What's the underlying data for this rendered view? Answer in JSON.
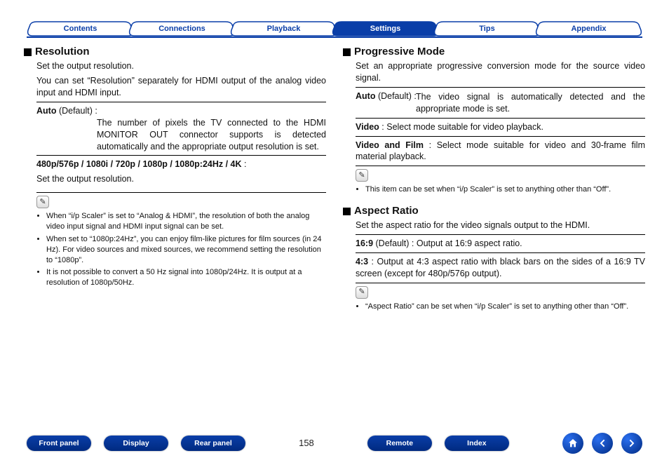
{
  "topnav": {
    "tabs": [
      {
        "label": "Contents",
        "active": false
      },
      {
        "label": "Connections",
        "active": false
      },
      {
        "label": "Playback",
        "active": false
      },
      {
        "label": "Settings",
        "active": true
      },
      {
        "label": "Tips",
        "active": false
      },
      {
        "label": "Appendix",
        "active": false
      }
    ]
  },
  "left": {
    "resolution": {
      "title": "Resolution",
      "intro1": "Set the output resolution.",
      "intro2": "You can set “Resolution” separately for HDMI output of the analog video input and HDMI input.",
      "auto_term": "Auto",
      "auto_default": " (Default) : ",
      "auto_desc": "The number of pixels the TV connected to the HDMI MONITOR OUT connector supports is detected automatically and the appropriate output resolution is set.",
      "modes_term": "480p/576p / 1080i / 720p / 1080p / 1080p:24Hz / 4K",
      "modes_colon": " :",
      "modes_desc": "Set the output resolution.",
      "notes": [
        "When “i/p Scaler” is set to “Analog & HDMI”, the resolution of both the analog video input signal and HDMI input signal can be set.",
        "When set to “1080p:24Hz”, you can enjoy film-like pictures for film sources (in 24 Hz). For video sources and mixed sources, we recommend setting the resolution to “1080p”.",
        "It is not possible to convert a 50 Hz signal into 1080p/24Hz. It is output at a resolution of 1080p/50Hz."
      ]
    }
  },
  "right": {
    "progressive": {
      "title": "Progressive Mode",
      "intro": "Set an appropriate progressive conversion mode for the source video signal.",
      "auto_term": "Auto",
      "auto_default": " (Default) : ",
      "auto_desc": "The video signal is automatically detected and the appropriate mode is set.",
      "video_term": "Video",
      "video_desc": " : Select mode suitable for video playback.",
      "vf_term": "Video and Film",
      "vf_desc": " : Select mode suitable for video and 30-frame film material playback.",
      "note": "This item can be set when “i/p Scaler” is set to anything other than “Off”."
    },
    "aspect": {
      "title": "Aspect Ratio",
      "intro": "Set the aspect ratio for the video signals output to the HDMI.",
      "r169_term": "16:9",
      "r169_default": " (Default) : ",
      "r169_desc": "Output at 16:9 aspect ratio.",
      "r43_term": "4:3",
      "r43_desc": " : Output at 4:3 aspect ratio with black bars on the sides of a 16:9 TV screen (except for 480p/576p output).",
      "note": "“Aspect Ratio” can be set when “i/p Scaler” is set to anything other than “Off”."
    }
  },
  "bottom": {
    "pills_left": [
      "Front panel",
      "Display",
      "Rear panel"
    ],
    "page": "158",
    "pills_right": [
      "Remote",
      "Index"
    ]
  }
}
